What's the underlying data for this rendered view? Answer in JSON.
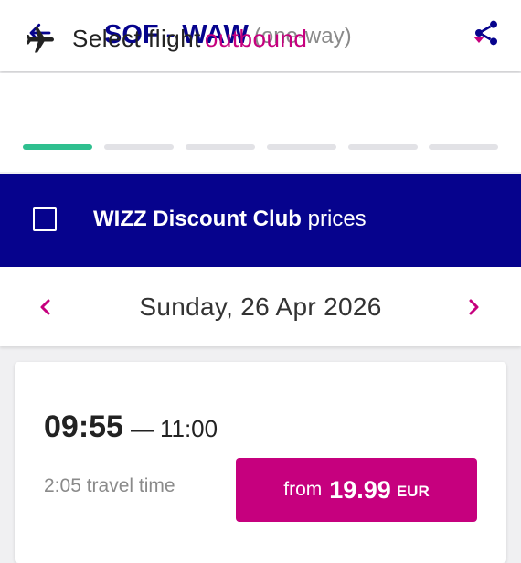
{
  "header": {
    "route": "SOF - WAW",
    "trip_type": "(one-way)",
    "back_icon": "arrow-left-icon",
    "share_icon": "share-icon"
  },
  "selector": {
    "label": "Select flight",
    "direction": "outbound",
    "plane_icon": "airplane-icon",
    "dropdown_icon": "caret-down-icon",
    "steps_total": 6,
    "steps_active": 1
  },
  "discount": {
    "brand": "WIZZ Discount Club",
    "suffix": "prices",
    "checked": false
  },
  "date_nav": {
    "date": "Sunday, 26 Apr 2026",
    "prev_icon": "chevron-left-icon",
    "next_icon": "chevron-right-icon"
  },
  "flight": {
    "departure": "09:55",
    "separator": "—",
    "arrival": "11:00",
    "duration": "2:05 travel time",
    "price_prefix": "from",
    "price": "19.99",
    "currency": "EUR"
  },
  "colors": {
    "brand_navy": "#06038d",
    "accent_magenta": "#c6007e",
    "progress_active": "#2fbf8f",
    "progress_inactive": "#e2e2e6"
  }
}
